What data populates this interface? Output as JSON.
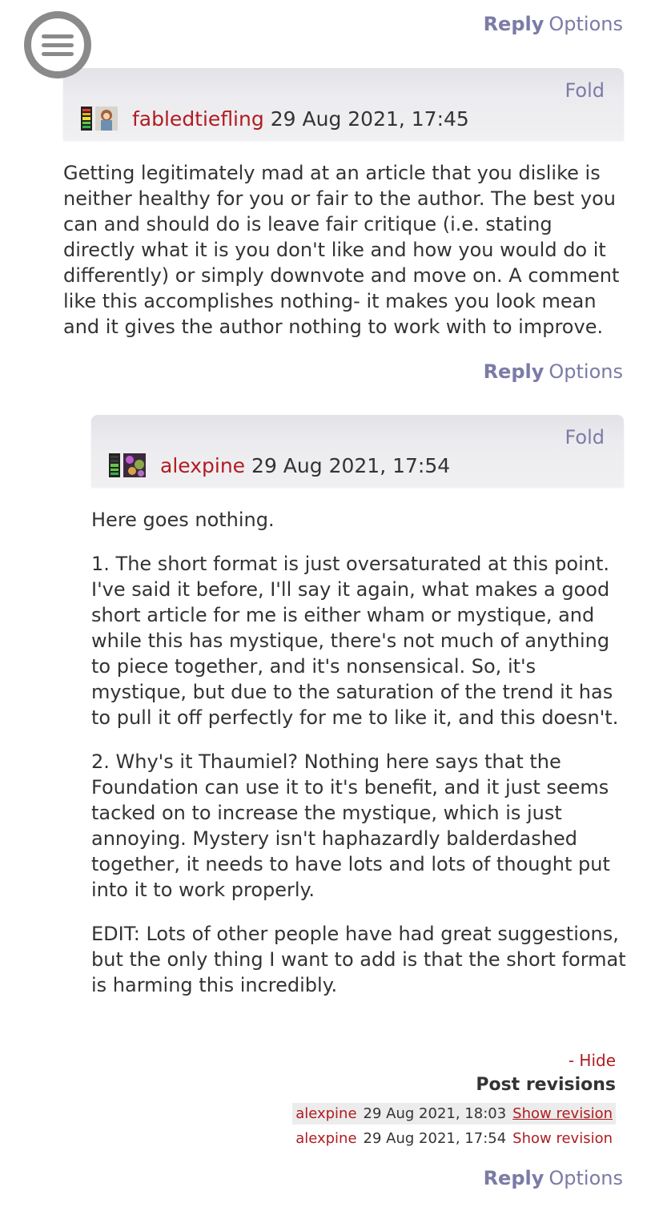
{
  "top_actions": {
    "reply": "Reply",
    "options": "Options"
  },
  "comment1": {
    "fold": "Fold",
    "author": "fabledtiefling",
    "date": "29 Aug 2021, 17:45",
    "body": "Getting legitimately mad at an article that you dislike is neither healthy for you or fair to the author. The best you can and should do is leave fair critique (i.e. stating directly what it is you don't like and how you would do it differently) or simply downvote and move on. A comment like this accomplishes nothing- it makes you look mean and it gives the author nothing to work with to improve.",
    "reply": "Reply",
    "options": "Options"
  },
  "comment2": {
    "fold": "Fold",
    "author": "alexpine",
    "date": "29 Aug 2021, 17:54",
    "paragraphs": [
      "Here goes nothing.",
      "1. The short format is just oversaturated at this point. I've said it before, I'll say it again, what makes a good short article for me is either wham or mystique, and while this has mystique, there's not much of anything to piece together, and it's nonsensical. So, it's mystique, but due to the saturation of the trend it has to pull it off perfectly for me to like it, and this doesn't.",
      "2. Why's it Thaumiel? Nothing here says that the Foundation can use it to it's benefit, and it just seems tacked on to increase the mystique, which is just annoying. Mystery isn't haphazardly balderdashed together, it needs to have lots and lots of thought put into it to work properly.",
      "EDIT: Lots of other people have had great suggestions, but the only thing I want to add is that the short format is harming this incredibly."
    ],
    "revisions": {
      "hide": "- Hide",
      "title": "Post revisions",
      "rows": [
        {
          "author": "alexpine",
          "date": "29 Aug 2021, 18:03",
          "link": "Show revision"
        },
        {
          "author": "alexpine",
          "date": "29 Aug 2021, 17:54",
          "link": "Show revision"
        }
      ]
    },
    "reply": "Reply",
    "options": "Options"
  },
  "colors": {
    "link": "#7b7ba6",
    "author": "#b01c20",
    "header_bg": "#ececf0"
  }
}
